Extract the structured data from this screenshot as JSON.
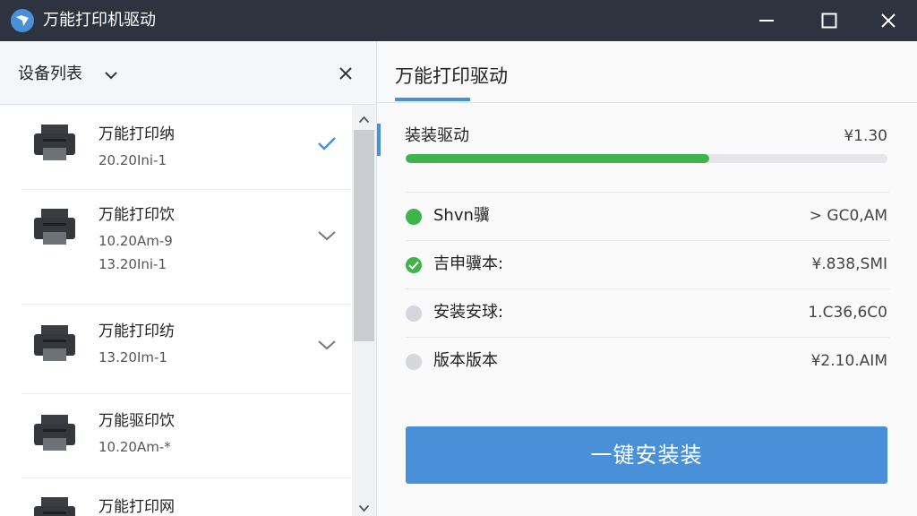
{
  "window": {
    "title": "万能打印机驱动",
    "colors": {
      "titlebar": "#2d3440",
      "accent": "#4a90d9",
      "success": "#3db54a",
      "pending": "#d5d7da"
    }
  },
  "device_list": {
    "title": "设备列表",
    "items": [
      {
        "name": "万能打印纳",
        "lines": [
          "20.20Ini-1"
        ],
        "mark": "check-icon"
      },
      {
        "name": "万能打印饮",
        "lines": [
          "10.20Am-9",
          "13.20Ini-1"
        ],
        "mark": "chevron-down-icon"
      },
      {
        "name": "万能打印纺",
        "lines": [
          "13.20Im-1"
        ],
        "mark": "chevron-down-icon"
      },
      {
        "name": "万能驱印饮",
        "lines": [
          "10.20Am-*"
        ],
        "mark": ""
      },
      {
        "name": "万能打印网",
        "lines": [],
        "mark": ""
      }
    ]
  },
  "driver_panel": {
    "title": "万能打印驱动",
    "progress": {
      "label": "装装驱动",
      "value": "¥1.30",
      "percent": 63
    },
    "rows": [
      {
        "label": "Shvn骥",
        "value": "> GC0,AM",
        "state": "ok"
      },
      {
        "label": "吉申骥本:",
        "value": "¥.838,SMI",
        "state": "done"
      },
      {
        "label": "安装安球:",
        "value": "1.C36,6C0",
        "state": "pending"
      },
      {
        "label": "版本版本",
        "value": "¥2.10.AIM",
        "state": "pending"
      }
    ],
    "install_button": "一键安装装"
  }
}
